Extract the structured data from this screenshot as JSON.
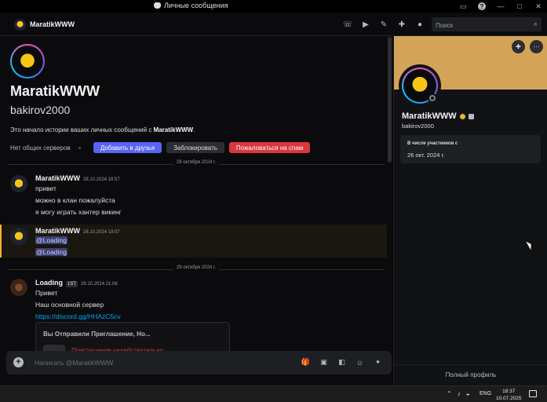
{
  "window": {
    "title": "Личные сообщения",
    "controls": [
      "inbox-icon",
      "help-icon",
      "minimize-icon",
      "maximize-icon",
      "close-icon"
    ]
  },
  "header": {
    "name": "MaratikWWW",
    "icons": [
      "phone-icon",
      "video-icon",
      "pin-icon",
      "add-friend-icon",
      "profile-toggle-icon"
    ],
    "search_placeholder": "Поиск"
  },
  "intro": {
    "display_name": "MaratikWWW",
    "username": "bakirov2000",
    "history_text": "Это начало истории ваших личных сообщений с ",
    "history_name": "MaratikWWW",
    "history_end": ".",
    "no_servers": "Нет общих серверов",
    "add_friend": "Добавить в друзья",
    "block": "Заблокировать",
    "report": "Пожаловаться на спам"
  },
  "messages": {
    "date1": "28 октября 2024 г.",
    "group1": {
      "author": "MaratikWWW",
      "time": "28.10.2024 18:57",
      "lines": [
        "привет",
        "можно в клан пожалуйста",
        "я могу играть хантер викинг"
      ]
    },
    "group2": {
      "author": "MaratikWWW",
      "time": "28.10.2024 19:07",
      "lines": [
        "@Loading",
        "@Loading"
      ]
    },
    "date2": "29 октября 2024 г.",
    "group3": {
      "author": "Loading",
      "badge": "1ST",
      "time": "29.10.2024 21:08",
      "lines": [
        "Привет",
        "Наш основной сервер"
      ],
      "link": "https://discord.gg/HHAzC5cv"
    },
    "invite": {
      "title": "Вы Отправили Приглашение, Но...",
      "status": "Приглашение недействительно"
    }
  },
  "composer": {
    "placeholder": "Написать @MaratikWWW",
    "icons": [
      "gift-icon",
      "gif-icon",
      "sticker-icon",
      "emoji-icon",
      "apps-icon"
    ]
  },
  "profile": {
    "display_name": "MaratikWWW",
    "username": "bakirov2000",
    "member_since_label": "В числе участников с",
    "member_since": "26 окт. 2024 г.",
    "full_profile": "Полный профиль",
    "banner_color": "#d3a458"
  },
  "taskbar": {
    "lang": "ENG",
    "time": "18:37",
    "date": "10.07.2025"
  }
}
